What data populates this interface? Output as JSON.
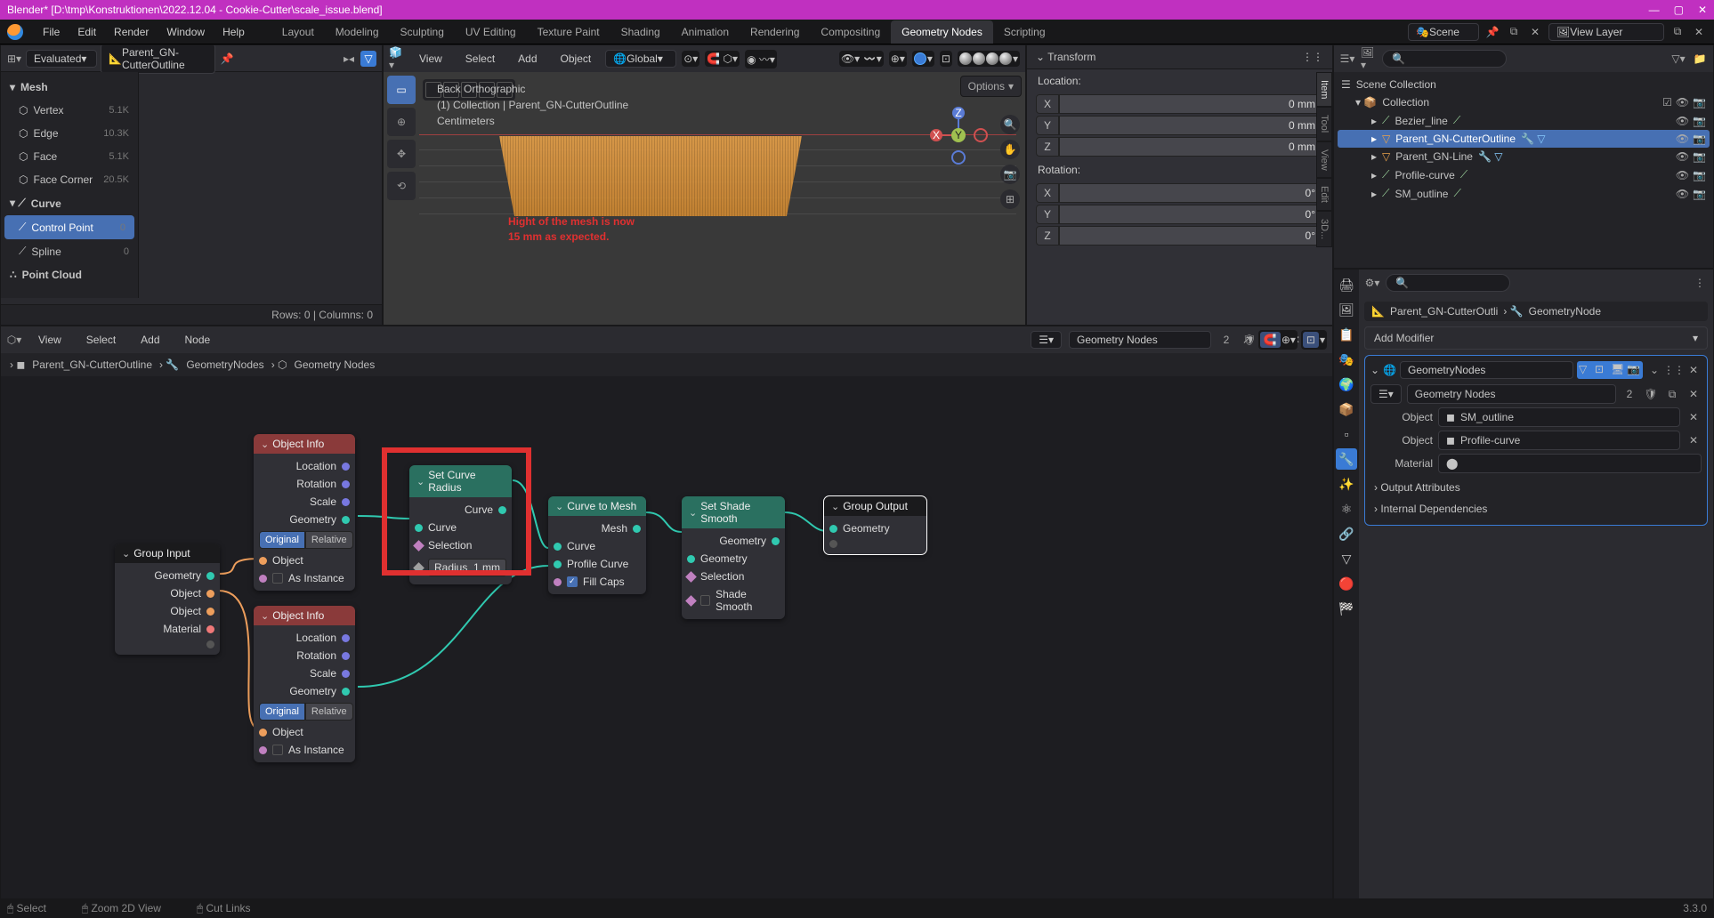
{
  "title": "Blender* [D:\\tmp\\Konstruktionen\\2022.12.04 - Cookie-Cutter\\scale_issue.blend]",
  "version": "3.3.0",
  "menus": [
    "File",
    "Edit",
    "Render",
    "Window",
    "Help"
  ],
  "workspaces": [
    "Layout",
    "Modeling",
    "Sculpting",
    "UV Editing",
    "Texture Paint",
    "Shading",
    "Animation",
    "Rendering",
    "Compositing",
    "Geometry Nodes",
    "Scripting"
  ],
  "active_workspace": "Geometry Nodes",
  "scene": "Scene",
  "view_layer": "View Layer",
  "spreadsheet": {
    "eval_mode": "Evaluated",
    "object": "Parent_GN-CutterOutline",
    "roots": [
      {
        "label": "Mesh",
        "items": [
          {
            "label": "Vertex",
            "count": "5.1K"
          },
          {
            "label": "Edge",
            "count": "10.3K"
          },
          {
            "label": "Face",
            "count": "5.1K"
          },
          {
            "label": "Face Corner",
            "count": "20.5K"
          }
        ]
      },
      {
        "label": "Curve",
        "items": [
          {
            "label": "Control Point",
            "count": "0",
            "sel": true
          },
          {
            "label": "Spline",
            "count": "0"
          }
        ]
      },
      {
        "label": "Point Cloud",
        "items": []
      }
    ],
    "status": "Rows: 0   |   Columns: 0"
  },
  "viewport": {
    "menus": [
      "View",
      "Select",
      "Add",
      "Object"
    ],
    "orient": "Global",
    "overlay_view": "Back Orthographic",
    "overlay_coll": "(1) Collection | Parent_GN-CutterOutline",
    "overlay_units": "Centimeters",
    "annotation_l1": "Hight of the mesh is now",
    "annotation_l2": "15 mm as expected.",
    "options_label": "Options"
  },
  "npanel": {
    "section": "Transform",
    "location_label": "Location:",
    "rotation_label": "Rotation:",
    "loc": {
      "X": "0 mm",
      "Y": "0 mm",
      "Z": "0 mm"
    },
    "rot": {
      "X": "0°",
      "Y": "0°",
      "Z": "0°"
    },
    "tabs": [
      "Item",
      "Tool",
      "View",
      "Edit",
      "3D..."
    ]
  },
  "outliner": {
    "root": "Scene Collection",
    "coll": "Collection",
    "items": [
      {
        "name": "Bezier_line",
        "type": "curve"
      },
      {
        "name": "Parent_GN-CutterOutline",
        "type": "mesh",
        "sel": true
      },
      {
        "name": "Parent_GN-Line",
        "type": "mesh"
      },
      {
        "name": "Profile-curve",
        "type": "curve"
      },
      {
        "name": "SM_outline",
        "type": "curve"
      }
    ]
  },
  "props": {
    "bread_obj": "Parent_GN-CutterOutli",
    "bread_mod": "GeometryNode",
    "addmod": "Add Modifier",
    "mod_name": "GeometryNodes",
    "node_group": "Geometry Nodes",
    "node_group_users": "2",
    "inputs": [
      {
        "label": "Object",
        "value": "SM_outline"
      },
      {
        "label": "Object",
        "value": "Profile-curve"
      },
      {
        "label": "Material",
        "value": ""
      }
    ],
    "output_attrs": "Output Attributes",
    "internal_deps": "Internal Dependencies"
  },
  "node_editor": {
    "menus": [
      "View",
      "Select",
      "Add",
      "Node"
    ],
    "tree_name": "Geometry Nodes",
    "tree_users": "2",
    "bread": [
      "Parent_GN-CutterOutline",
      "GeometryNodes",
      "Geometry Nodes"
    ],
    "nodes": {
      "group_input": {
        "title": "Group Input",
        "outs": [
          "Geometry",
          "Object",
          "Object",
          "Material"
        ]
      },
      "object_info1": {
        "title": "Object Info",
        "outs": [
          "Location",
          "Rotation",
          "Scale",
          "Geometry"
        ],
        "btns": [
          "Original",
          "Relative"
        ],
        "active": 0,
        "extras": [
          "Object",
          "As Instance"
        ]
      },
      "object_info2": {
        "title": "Object Info",
        "outs": [
          "Location",
          "Rotation",
          "Scale",
          "Geometry"
        ],
        "btns": [
          "Original",
          "Relative"
        ],
        "active": 0,
        "extras": [
          "Object",
          "As Instance"
        ]
      },
      "set_curve_radius": {
        "title": "Set Curve Radius",
        "out": "Curve",
        "ins": [
          "Curve",
          "Selection"
        ],
        "field": {
          "label": "Radius",
          "value": "1 mm"
        }
      },
      "curve_to_mesh": {
        "title": "Curve to Mesh",
        "out": "Mesh",
        "ins": [
          "Curve",
          "Profile Curve"
        ],
        "check": "Fill Caps",
        "checked": true
      },
      "set_shade_smooth": {
        "title": "Set Shade Smooth",
        "out": "Geometry",
        "ins": [
          "Geometry",
          "Selection",
          "Shade Smooth"
        ]
      },
      "group_output": {
        "title": "Group Output",
        "ins": [
          "Geometry"
        ]
      }
    }
  },
  "statusbar": {
    "items": [
      "Select",
      "Zoom 2D View",
      "Cut Links"
    ]
  }
}
